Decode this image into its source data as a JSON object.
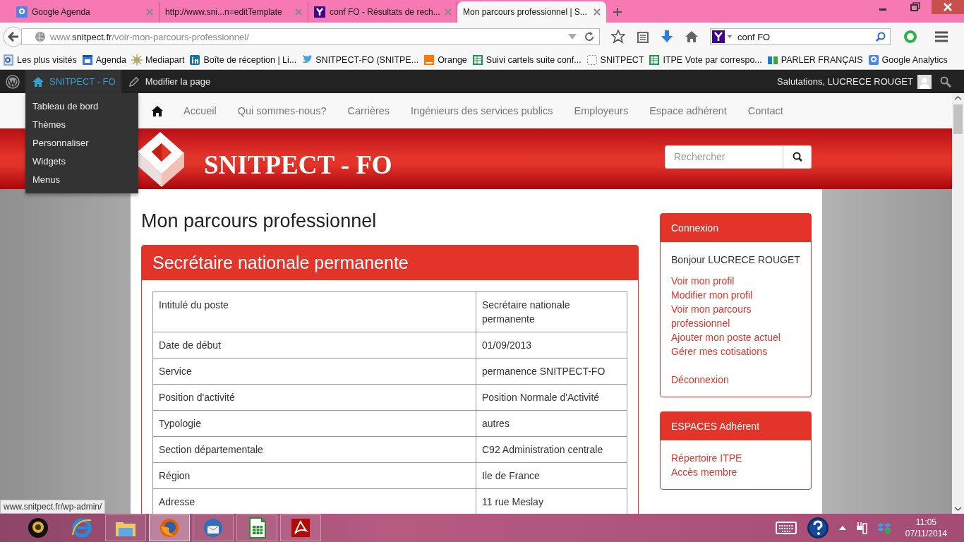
{
  "browser": {
    "tabs": [
      {
        "title": "Google Agenda",
        "kind": "google",
        "selected": false
      },
      {
        "title": "http://www.sni...n=editTemplate",
        "kind": "plain",
        "selected": false
      },
      {
        "title": "conf FO - Résultats de rech...",
        "kind": "yahoo",
        "selected": false
      },
      {
        "title": "Mon parcours professionnel | S...",
        "kind": "plain",
        "selected": true
      }
    ],
    "url": "www.**snitpect.fr**/voir-mon-parcours-professionnel/",
    "search": {
      "value": "conf FO"
    },
    "bookmarks": [
      {
        "label": "Les plus visités",
        "kind": "page"
      },
      {
        "label": "Agenda",
        "kind": "calendar"
      },
      {
        "label": "Mediapart",
        "kind": "sun"
      },
      {
        "label": "Boîte de réception | Li...",
        "kind": "linkedin"
      },
      {
        "label": "SNITPECT-FO (SNITPE...",
        "kind": "bird"
      },
      {
        "label": "Orange",
        "kind": "orange"
      },
      {
        "label": "Suivi cartels suite conf...",
        "kind": "sheet"
      },
      {
        "label": "SNITPECT",
        "kind": "blank"
      },
      {
        "label": "ITPE Vote par correspo...",
        "kind": "sheet"
      },
      {
        "label": "PARLER FRANÇAIS",
        "kind": "bars"
      },
      {
        "label": "Google Analytics",
        "kind": "google"
      }
    ]
  },
  "admin_bar": {
    "site": "SNITPECT - FO",
    "edit": "Modifier la page",
    "greeting": "Salutations, LUCRECE ROUGET",
    "menu": [
      "Tableau de bord",
      "Thèmes",
      "Personnaliser",
      "Widgets",
      "Menus"
    ]
  },
  "site_nav": [
    "Accueil",
    "Qui sommes-nous?",
    "Carrières",
    "Ingénieurs des services publics",
    "Employeurs",
    "Espace adhérent",
    "Contact"
  ],
  "header": {
    "title": "SNITPECT - FO",
    "search_placeholder": "Rechercher"
  },
  "page": {
    "heading": "Mon parcours professionnel",
    "card_title": "Secrétaire nationale permanente",
    "rows": [
      [
        "Intitulé du poste",
        "Secrétaire nationale permanente"
      ],
      [
        "Date de début",
        "01/09/2013"
      ],
      [
        "Service",
        "permanence SNITPECT-FO"
      ],
      [
        "Position d'activité",
        "Position Normale d'Activité"
      ],
      [
        "Typologie",
        "autres"
      ],
      [
        "Section départementale",
        "C92 Administration centrale"
      ],
      [
        "Région",
        "Ile de France"
      ],
      [
        "Adresse",
        "11 rue Meslay"
      ]
    ]
  },
  "sidebar": [
    {
      "title": "Connexion",
      "greeting": "Bonjour LUCRECE ROUGET",
      "links": [
        "Voir mon profil",
        "Modifier mon profil",
        "Voir mon parcours professionnel",
        "Ajouter mon poste actuel",
        "Gérer mes cotisations"
      ],
      "footer_links": [
        "Déconnexion"
      ]
    },
    {
      "title": "ESPACES Adhérent",
      "links": [
        "Répertoire ITPE",
        "Accès membre"
      ]
    }
  ],
  "status_url": "www.snitpect.fr/wp-admin/",
  "taskbar": {
    "apps": [
      {
        "kind": "webcam",
        "running": false,
        "selected": false
      },
      {
        "kind": "ie",
        "running": false,
        "selected": false
      },
      {
        "kind": "folder",
        "running": true,
        "selected": false
      },
      {
        "kind": "firefox",
        "running": true,
        "selected": true
      },
      {
        "kind": "mail",
        "running": true,
        "selected": false
      },
      {
        "kind": "calc",
        "running": true,
        "selected": false
      },
      {
        "kind": "pdf",
        "running": true,
        "selected": false
      }
    ],
    "time": "11:05",
    "date": "07/11/2014"
  }
}
